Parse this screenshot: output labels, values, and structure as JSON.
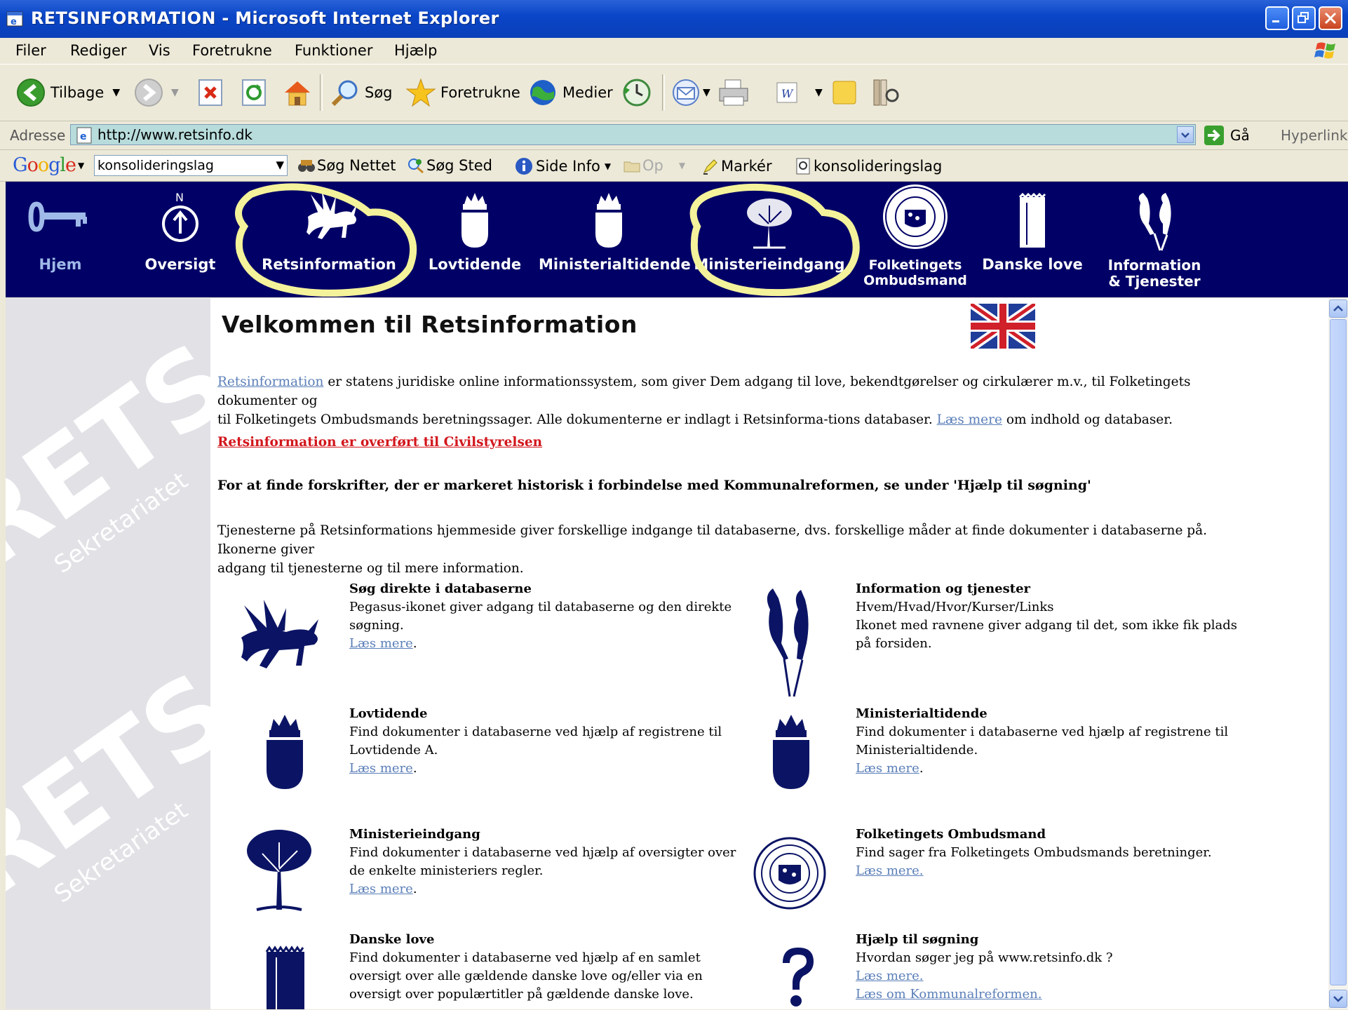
{
  "window": {
    "title": "RETSINFORMATION - Microsoft Internet Explorer"
  },
  "menu": [
    "Filer",
    "Rediger",
    "Vis",
    "Foretrukne",
    "Funktioner",
    "Hjælp"
  ],
  "toolbar": {
    "back": "Tilbage",
    "search": "Søg",
    "favorites": "Foretrukne",
    "media": "Medier"
  },
  "address": {
    "label": "Adresse",
    "url": "http://www.retsinfo.dk",
    "go": "Gå",
    "links": "Hyperlinks"
  },
  "google": {
    "query": "konsolideringslag",
    "search_web": "Søg Nettet",
    "search_site": "Søg Sted",
    "page_info": "Side Info",
    "up": "Op",
    "highlight": "Markér",
    "term": "konsolideringslag"
  },
  "nav": [
    {
      "label": "Hjem",
      "icon": "key-icon"
    },
    {
      "label": "Oversigt",
      "icon": "compass-icon"
    },
    {
      "label": "Retsinformation",
      "icon": "pegasus-icon"
    },
    {
      "label": "Lovtidende",
      "icon": "crown-seal-icon"
    },
    {
      "label": "Ministerialtidende",
      "icon": "crown-seal-icon"
    },
    {
      "label": "Ministerieindgang",
      "icon": "tree-icon"
    },
    {
      "label": "Folketingets",
      "label2": "Ombudsmand",
      "icon": "ombudsman-seal-icon"
    },
    {
      "label": "Danske love",
      "icon": "book-icon"
    },
    {
      "label": "Information",
      "label2": "& Tjenester",
      "icon": "ravens-icon"
    }
  ],
  "main": {
    "title": "Velkommen til Retsinformation",
    "intro_link": "Retsinformation",
    "intro_text1": " er statens juridiske online informationssystem, som giver Dem adgang til love, bekendtgørelser og cirkulærer m.v., til Folketingets dokumenter og",
    "intro_text2": "til Folketingets Ombudsmands beretningssager. Alle dokumenterne er indlagt i Retsinforma-tions databaser. ",
    "intro_more": "Læs mere",
    "intro_text3": " om indhold og databaser.",
    "red_link": "Retsinformation er overført til Civilstyrelsen",
    "bold_note": "For at finde forskrifter, der er markeret historisk i forbindelse med Kommunalreformen, se under 'Hjælp til søgning'",
    "services1": "Tjenesterne på Retsinformations hjemmeside giver forskellige indgange til databaserne, dvs. forskellige måder at finde dokumenter i databaserne på. Ikonerne giver",
    "services2": "adgang til tjenesterne og til mere information."
  },
  "blocks": [
    {
      "title": "Søg direkte i databaserne",
      "lines": [
        "Pegasus-ikonet giver adgang til databaserne og den direkte",
        "søgning."
      ],
      "link": "Læs mere",
      "suffix": "."
    },
    {
      "title": "Information og tjenester",
      "lines": [
        "Hvem/Hvad/Hvor/Kurser/Links",
        "Ikonet med ravnene giver adgang til det, som ikke fik plads",
        "på forsiden."
      ]
    },
    {
      "title": "Lovtidende",
      "lines": [
        "Find dokumenter i databaserne ved hjælp af registrene til",
        "Lovtidende A."
      ],
      "link": "Læs mere",
      "suffix": "."
    },
    {
      "title": "Ministerialtidende",
      "lines": [
        "Find dokumenter i databaserne ved hjælp af registrene til",
        "Ministerialtidende."
      ],
      "link": "Læs mere",
      "suffix": "."
    },
    {
      "title": "Ministerieindgang",
      "lines": [
        "Find dokumenter i databaserne ved hjælp af oversigter over",
        "de enkelte ministeriers regler."
      ],
      "link": "Læs mere",
      "suffix": "."
    },
    {
      "title": "Folketingets Ombudsmand",
      "lines": [
        "Find sager fra Folketingets Ombudsmands beretninger."
      ],
      "link": "Læs mere."
    },
    {
      "title": "Danske love",
      "lines": [
        "Find dokumenter i databaserne ved hjælp af en samlet",
        "oversigt over alle gældende danske love og/eller via en",
        "oversigt over populærtitler på gældende danske love."
      ]
    },
    {
      "title": "Hjælp til søgning",
      "lines": [
        "Hvordan søger jeg på www.retsinfo.dk ?"
      ],
      "link": "Læs mere.",
      "link2": "Læs om Kommunalreformen."
    }
  ],
  "colors": {
    "nav_bg": "#000066",
    "icon_navy": "#0b1464",
    "highlight_yellow": "#f4f29a",
    "red_link": "#d2161c"
  }
}
